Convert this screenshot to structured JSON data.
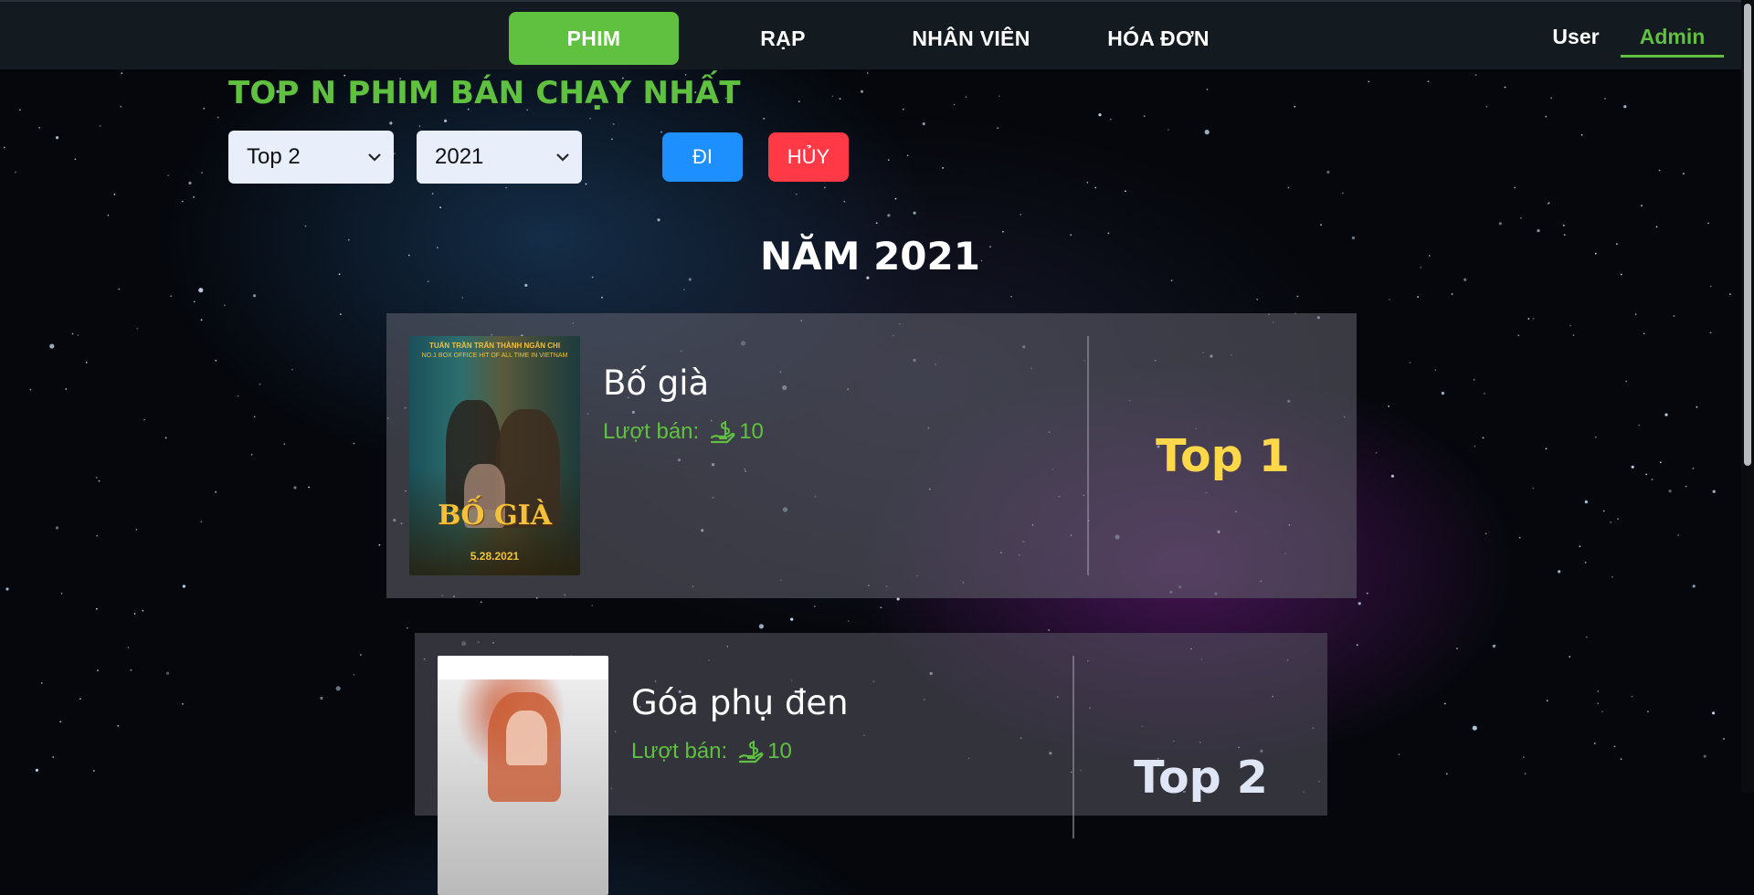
{
  "nav": {
    "tabs": [
      {
        "label": "PHIM",
        "active": true
      },
      {
        "label": "RẠP",
        "active": false
      },
      {
        "label": "NHÂN VIÊN",
        "active": false
      },
      {
        "label": "HÓA ĐƠN",
        "active": false
      }
    ],
    "roles": {
      "user": "User",
      "admin": "Admin",
      "active": "Admin"
    }
  },
  "page": {
    "heading": "TOP N PHIM BÁN CHẠY NHẤT",
    "year_heading": "NĂM 2021"
  },
  "filters": {
    "top_value": "Top 2",
    "year_value": "2021",
    "go_label": "ĐI",
    "cancel_label": "HỦY"
  },
  "movies": [
    {
      "name": "Bố già",
      "sales_label": "Lượt bán:",
      "sales_count": "10",
      "rank_label": "Top 1",
      "poster": {
        "credits": "TUẤN TRẦN   TRẤN THÀNH   NGÂN CHI",
        "tagline": "NO.1 BOX OFFICE HIT OF ALL TIME IN VIETNAM",
        "title": "BỐ GIÀ",
        "release": "5.28.2021"
      }
    },
    {
      "name": "Góa phụ đen",
      "sales_label": "Lượt bán:",
      "sales_count": "10",
      "rank_label": "Top 2"
    }
  ],
  "colors": {
    "accent_green": "#5fc13f",
    "go_blue": "#1e8fff",
    "cancel_red": "#ff3a46",
    "rank_gold": "#ffd84a",
    "navbar_bg": "#131a20"
  },
  "icons": [
    "money-hand-icon",
    "chevron-down-icon"
  ]
}
